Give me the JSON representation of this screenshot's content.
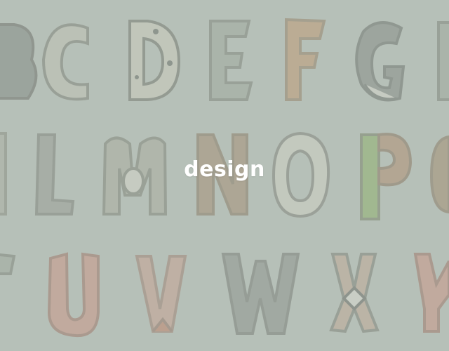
{
  "caption": "design",
  "background_color": "#b9c2ba",
  "caption_color": "#ffffff",
  "artwork": {
    "description_icon": "animal-alphabet-illustration"
  }
}
